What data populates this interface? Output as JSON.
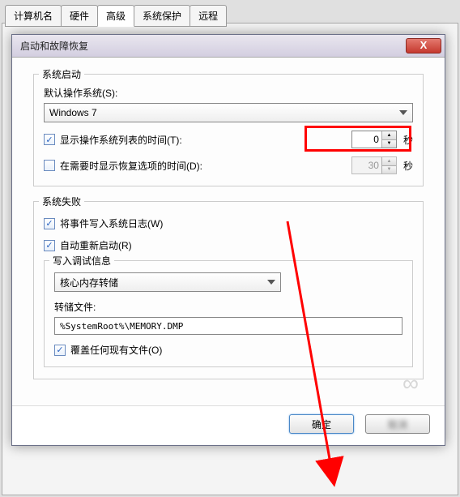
{
  "tabs": {
    "t0": "计算机名",
    "t1": "硬件",
    "t2": "高级",
    "t3": "系统保护",
    "t4": "远程"
  },
  "dialog": {
    "title": "启动和故障恢复",
    "close": "X"
  },
  "startup": {
    "group_title": "系统启动",
    "default_os_label": "默认操作系统(S):",
    "default_os_value": "Windows 7",
    "show_os_list_label": "显示操作系统列表的时间(T):",
    "show_os_list_value": "0",
    "show_recovery_label": "在需要时显示恢复选项的时间(D):",
    "show_recovery_value": "30",
    "seconds": "秒"
  },
  "failure": {
    "group_title": "系统失败",
    "write_event_label": "将事件写入系统日志(W)",
    "auto_restart_label": "自动重新启动(R)",
    "debug_group_title": "写入调试信息",
    "debug_combo_value": "核心内存转储",
    "dump_file_label": "转储文件:",
    "dump_file_value": "%SystemRoot%\\MEMORY.DMP",
    "overwrite_label": "覆盖任何现有文件(O)"
  },
  "buttons": {
    "ok": "确定",
    "cancel": "取消"
  },
  "checkmark": "✓"
}
